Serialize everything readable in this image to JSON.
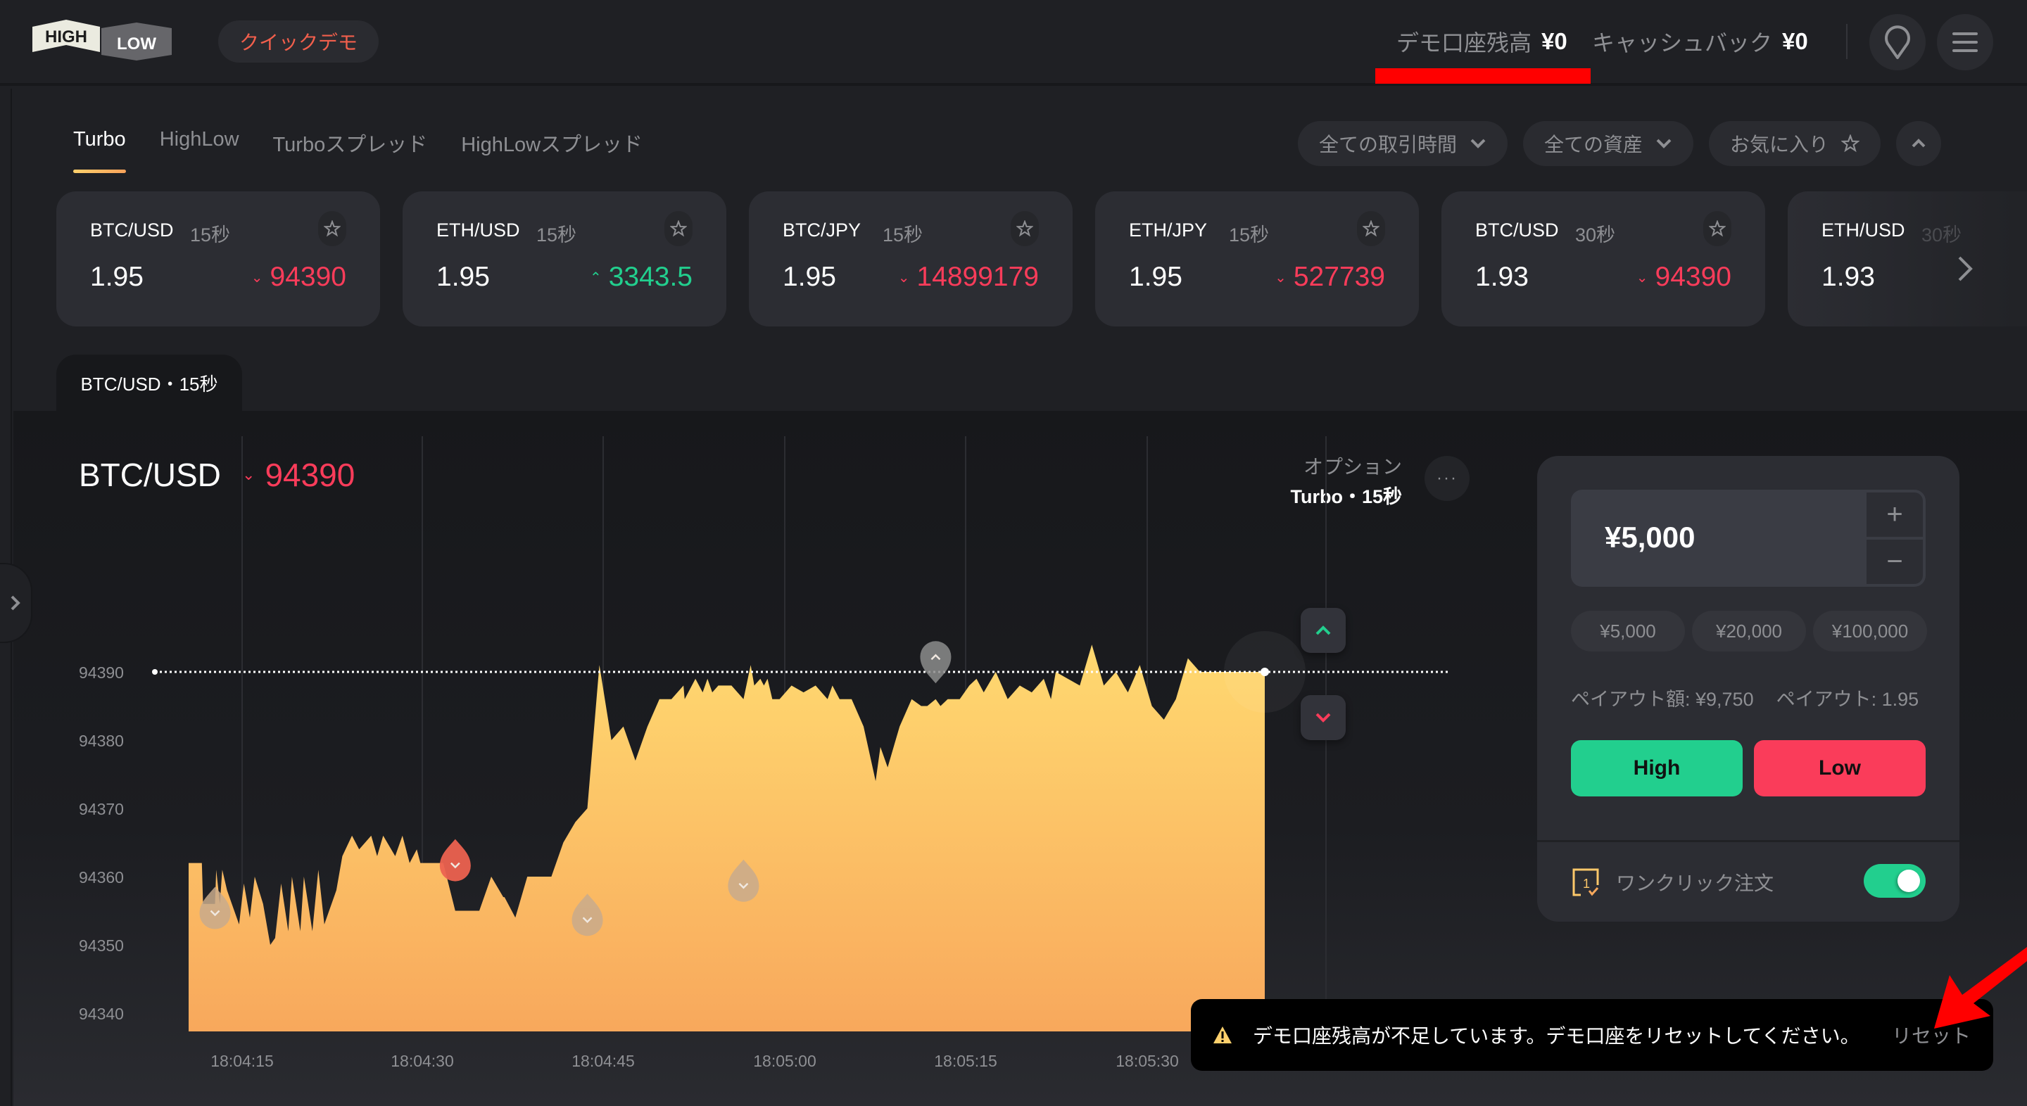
{
  "header": {
    "logo_high": "HIGH",
    "logo_low": "LOW",
    "quick_demo_label": "クイックデモ",
    "balance_label": "デモ口座残高",
    "balance_value": "¥0",
    "cashback_label": "キャッシュバック",
    "cashback_value": "¥0",
    "icons": [
      "location-pin-icon",
      "hamburger-menu-icon"
    ]
  },
  "tabs": [
    {
      "label": "Turbo",
      "active": true
    },
    {
      "label": "HighLow",
      "active": false
    },
    {
      "label": "Turboスプレッド",
      "active": false
    },
    {
      "label": "HighLowスプレッド",
      "active": false
    }
  ],
  "filters": {
    "trading_time": "全ての取引時間",
    "assets": "全ての資産",
    "favorites": "お気に入り"
  },
  "asset_cards": [
    {
      "name": "BTC/USD",
      "duration": "15秒",
      "payout": "1.95",
      "price": "94390",
      "direction": "down"
    },
    {
      "name": "ETH/USD",
      "duration": "15秒",
      "payout": "1.95",
      "price": "3343.5",
      "direction": "up"
    },
    {
      "name": "BTC/JPY",
      "duration": "15秒",
      "payout": "1.95",
      "price": "14899179",
      "direction": "down"
    },
    {
      "name": "ETH/JPY",
      "duration": "15秒",
      "payout": "1.95",
      "price": "527739",
      "direction": "down"
    },
    {
      "name": "BTC/USD",
      "duration": "30秒",
      "payout": "1.93",
      "price": "94390",
      "direction": "down"
    },
    {
      "name": "ETH/USD",
      "duration": "30秒",
      "payout": "1.93",
      "price": "",
      "direction": ""
    }
  ],
  "chart_tab": "BTC/USD・15秒",
  "asset": {
    "name": "BTC/USD",
    "price": "94390",
    "direction": "down"
  },
  "option": {
    "label": "オプション",
    "value": "Turbo・15秒"
  },
  "trade": {
    "amount": "¥5,000",
    "presets": [
      "¥5,000",
      "¥20,000",
      "¥100,000"
    ],
    "payout_amount": "ペイアウト額: ¥9,750",
    "payout_rate": "ペイアウト: 1.95",
    "high_label": "High",
    "low_label": "Low",
    "one_click_label": "ワンクリック注文",
    "one_click_enabled": true
  },
  "toast": {
    "message": "デモ口座残高が不足しています。デモ口座をリセットしてください。",
    "action": "リセット"
  },
  "colors": {
    "up": "#22cf8e",
    "down": "#fa3c5a",
    "accent": "#fdd06c",
    "quick_demo": "#f25f4c"
  },
  "chart_data": {
    "type": "area",
    "title": "BTC/USD",
    "xlabel": "",
    "ylabel": "",
    "ylim": [
      94337,
      94398
    ],
    "y_ticks": [
      94390,
      94380,
      94370,
      94360,
      94350,
      94340
    ],
    "x_ticks": [
      "18:04:15",
      "18:04:30",
      "18:04:45",
      "18:05:00",
      "18:05:15",
      "18:05:30"
    ],
    "current_price_line": 94390,
    "series": [
      {
        "name": "price",
        "t": [
          0,
          1.1,
          1.2,
          2.2,
          2.3,
          2.6,
          2.8,
          3.2,
          3.6,
          4.2,
          4.6,
          5.1,
          5.5,
          6.2,
          6.8,
          7.2,
          7.7,
          8.3,
          8.6,
          9.3,
          9.6,
          10.3,
          10.8,
          11.3,
          12.3,
          12.8,
          13.6,
          14.2,
          15.2,
          15.7,
          16.2,
          17.2,
          17.8,
          18.4,
          19.0,
          19.3,
          20.2,
          21.2,
          22.2,
          23.2,
          24.2,
          25.2,
          26.2,
          26.3,
          27.2,
          28.2,
          28.3,
          28.8,
          29.5,
          30.2,
          31.2,
          32.2,
          33.2,
          34.2,
          35.2,
          36.2,
          37.2,
          38.2,
          39.2,
          40.2,
          41.2,
          41.3,
          42.2,
          42.8,
          43.2,
          43.6,
          44.1,
          44.6,
          45.2,
          46.2,
          46.8,
          47.1,
          47.6,
          47.9,
          48.2,
          48.6,
          49.2,
          50.2,
          51.2,
          52.2,
          53.2,
          53.6,
          54.2,
          55.2,
          56.2,
          57.2,
          57.6,
          58.2,
          59.2,
          60.2,
          61.0,
          61.5,
          62.2,
          62.6,
          63.2,
          64.2,
          65.0,
          65.6,
          66.2,
          67.2,
          68.2,
          69.2,
          70.2,
          71.2,
          71.8,
          72.2,
          73.2,
          74.2,
          75.2,
          76.2,
          77.2,
          78.2,
          79.2,
          80.2,
          81.2,
          82.2,
          83.2,
          84.2,
          85.2,
          86.2,
          86.8,
          87.2,
          88.2,
          89.2,
          89.6
        ],
        "values": [
          94362,
          94362,
          94356,
          94356,
          94361,
          94356,
          94361,
          94358,
          94356,
          94353,
          94359,
          94354,
          94360,
          94356,
          94350,
          94351,
          94359,
          94352,
          94360,
          94352,
          94360,
          94352,
          94361,
          94353,
          94358,
          94363,
          94366,
          94364,
          94366,
          94363,
          94366,
          94363,
          94366,
          94362,
          94364,
          94362,
          94362,
          94362,
          94355,
          94355,
          94355,
          94360,
          94357,
          94357,
          94354,
          94360,
          94360,
          94360,
          94360,
          94360,
          94365,
          94368,
          94370,
          94391,
          94380,
          94382,
          94377,
          94382,
          94386,
          94386,
          94388,
          94386,
          94389,
          94387,
          94389,
          94387,
          94388,
          94388,
          94388,
          94386,
          94391,
          94388,
          94389,
          94388,
          94389,
          94386,
          94386,
          94388,
          94387,
          94388,
          94386,
          94388,
          94386,
          94386,
          94382,
          94374,
          94379,
          94376,
          94382,
          94386,
          94385,
          94385,
          94386,
          94385,
          94386,
          94386,
          94388,
          94389,
          94387,
          94390,
          94386,
          94388,
          94387,
          94389,
          94386,
          94390,
          94389,
          94388,
          94394,
          94388,
          94390,
          94387,
          94391,
          94385,
          94383,
          94386,
          94392,
          94390,
          94390,
          94390,
          94390,
          94390,
          94390,
          94390,
          94390,
          94390,
          94390
        ]
      }
    ],
    "trade_markers": [
      {
        "t": 2.2,
        "price": 94355,
        "direction": "down",
        "status": "neutral"
      },
      {
        "t": 22.2,
        "price": 94362,
        "direction": "down",
        "status": "active"
      },
      {
        "t": 33.2,
        "price": 94354,
        "direction": "down",
        "status": "neutral"
      },
      {
        "t": 46.2,
        "price": 94359,
        "direction": "down",
        "status": "neutral"
      },
      {
        "t": 62.2,
        "price": 94391,
        "direction": "up",
        "status": "neutral"
      }
    ]
  }
}
